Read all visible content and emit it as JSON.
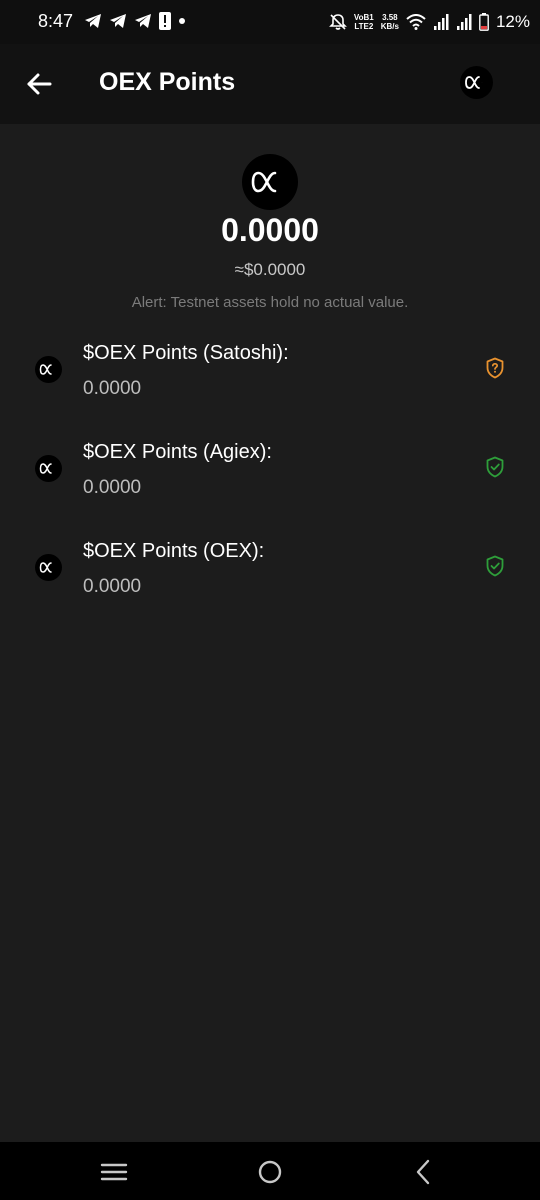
{
  "status_bar": {
    "time": "8:47",
    "net_label_top": "VoB1",
    "net_label_bottom": "LTE2",
    "speed_value": "3.58",
    "speed_unit": "KB/s",
    "battery_percent": "12%"
  },
  "header": {
    "title": "OEX Points",
    "back_icon": "arrow-left-icon",
    "avatar_icon": "oex-logo-icon"
  },
  "balance": {
    "amount": "0.0000",
    "usd_value": "≈$0.0000",
    "alert": "Alert: Testnet assets hold no actual value."
  },
  "assets": [
    {
      "name": "$OEX Points (Satoshi):",
      "balance": "0.0000",
      "status_icon": "shield-question-icon",
      "status_color": "#e8922f"
    },
    {
      "name": "$OEX Points (Agiex):",
      "balance": "0.0000",
      "status_icon": "shield-check-icon",
      "status_color": "#2e9e3a"
    },
    {
      "name": "$OEX Points (OEX):",
      "balance": "0.0000",
      "status_icon": "shield-check-icon",
      "status_color": "#2e9e3a"
    }
  ],
  "colors": {
    "background": "#1c1c1c",
    "header": "#121212",
    "status_bar": "#0f0f0f",
    "nav_bar": "#000000",
    "muted_text": "#7b7b7b",
    "warning": "#e8922f",
    "verified": "#2e9e3a"
  },
  "nav_bar": {
    "recents_icon": "menu-icon",
    "home_icon": "home-circle-icon",
    "back_icon": "chevron-left-icon"
  }
}
